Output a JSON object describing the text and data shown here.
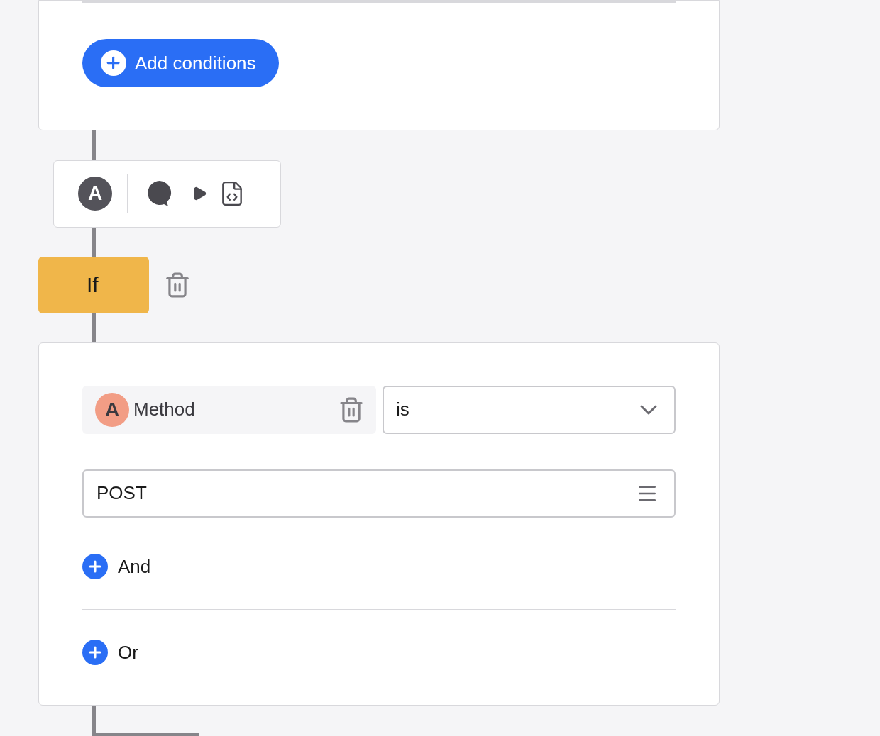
{
  "top_card": {
    "add_button": "Add conditions"
  },
  "toolbar": {
    "avatar": "A"
  },
  "if_block": {
    "label": "If"
  },
  "condition_card": {
    "field": {
      "avatar": "A",
      "label": "Method"
    },
    "operator": {
      "value": "is"
    },
    "value_input": {
      "value": "POST"
    },
    "and_button": "And",
    "or_button": "Or"
  }
}
